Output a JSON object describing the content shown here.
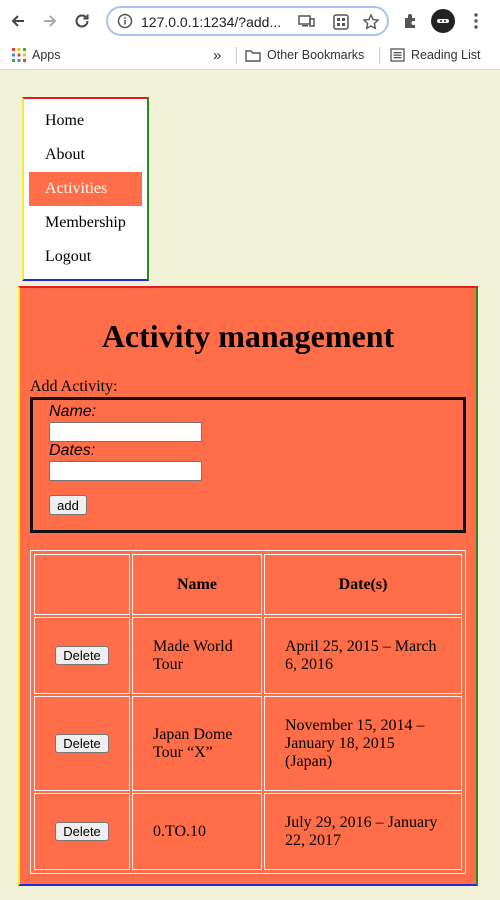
{
  "browser": {
    "url": "127.0.0.1:1234/?add...",
    "bookmarks": {
      "apps": "Apps",
      "overflow": "»",
      "other": "Other Bookmarks",
      "reading_list": "Reading List"
    }
  },
  "nav": {
    "items": [
      {
        "label": "Home"
      },
      {
        "label": "About"
      },
      {
        "label": "Activities"
      },
      {
        "label": "Membership"
      },
      {
        "label": "Logout"
      }
    ],
    "active": "Activities"
  },
  "main": {
    "title": "Activity management",
    "add_label": "Add Activity:",
    "form": {
      "name_label": "Name:",
      "name_value": "",
      "dates_label": "Dates:",
      "dates_value": "",
      "add_button": "add"
    },
    "table": {
      "headers": [
        "",
        "Name",
        "Date(s)"
      ],
      "delete_label": "Delete",
      "rows": [
        {
          "name": "Made World Tour",
          "dates": "April 25, 2015 – March 6, 2016"
        },
        {
          "name": "Japan Dome Tour “X”",
          "dates": "November 15, 2014 – January 18, 2015 (Japan)"
        },
        {
          "name": "0.TO.10",
          "dates": "July 29, 2016 – January 22, 2017"
        }
      ]
    }
  },
  "colors": {
    "page_bg": "#f2f2d8",
    "accent": "#ff6e48",
    "border_top": "#e0201e",
    "border_right": "#2b8a1f",
    "border_bottom": "#2a2ad6",
    "border_left": "#f6ec2e"
  }
}
